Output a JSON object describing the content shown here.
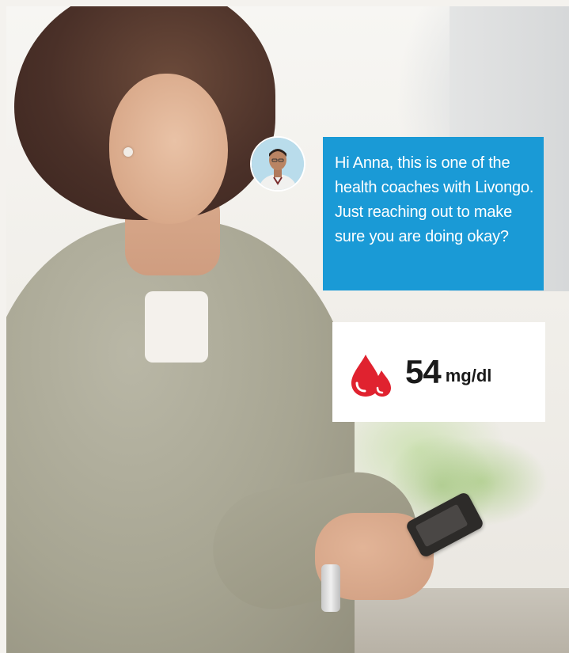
{
  "coach": {
    "avatar_icon": "coach-avatar-icon",
    "message": "Hi Anna, this is one of the health coaches with Livongo. Just reaching out to make sure you are doing okay?",
    "bubble_color": "#1a9ad6"
  },
  "reading": {
    "icon": "blood-drops-icon",
    "icon_color": "#e0222f",
    "value": "54",
    "unit": "mg/dl"
  },
  "scene": {
    "photo_description_icon": "woman-with-glucose-meter-photo"
  }
}
